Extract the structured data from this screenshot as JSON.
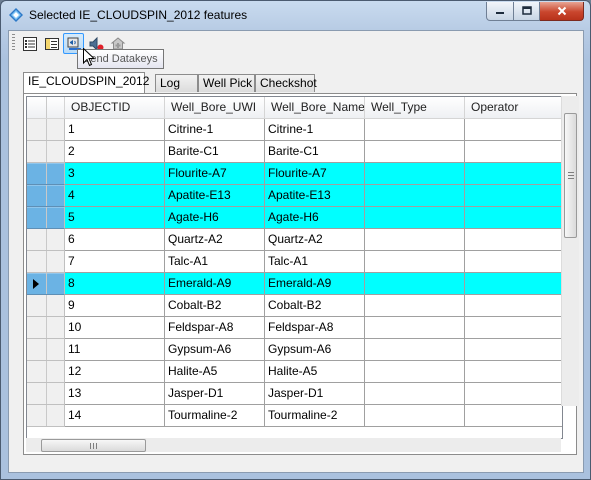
{
  "window": {
    "title": "Selected IE_CLOUDSPIN_2012 features",
    "icon": "layer-diamond-icon"
  },
  "toolbar": {
    "buttons": [
      {
        "icon": "attribute-table-icon"
      },
      {
        "icon": "select-columns-icon"
      },
      {
        "icon": "send-datakeys-icon",
        "active": true
      },
      {
        "icon": "speaker-stop-icon"
      },
      {
        "icon": "house-pin-icon"
      }
    ],
    "tooltip": "Send Datakeys"
  },
  "tabs": [
    {
      "label": "IE_CLOUDSPIN_2012",
      "selected": true
    },
    {
      "label": "Log"
    },
    {
      "label": "Well Pick"
    },
    {
      "label": "Checkshot"
    }
  ],
  "grid": {
    "columns": [
      "OBJECTID",
      "Well_Bore_UWI",
      "Well_Bore_Name",
      "Well_Type",
      "Operator"
    ],
    "rows": [
      {
        "id": "1",
        "uwi": "Citrine-1",
        "name": "Citrine-1",
        "type": "",
        "operator": "",
        "selected": false,
        "current": false
      },
      {
        "id": "2",
        "uwi": "Barite-C1",
        "name": "Barite-C1",
        "type": "",
        "operator": "",
        "selected": false,
        "current": false
      },
      {
        "id": "3",
        "uwi": "Flourite-A7",
        "name": "Flourite-A7",
        "type": "",
        "operator": "",
        "selected": true,
        "current": false
      },
      {
        "id": "4",
        "uwi": "Apatite-E13",
        "name": "Apatite-E13",
        "type": "",
        "operator": "",
        "selected": true,
        "current": false
      },
      {
        "id": "5",
        "uwi": "Agate-H6",
        "name": "Agate-H6",
        "type": "",
        "operator": "",
        "selected": true,
        "current": false
      },
      {
        "id": "6",
        "uwi": "Quartz-A2",
        "name": "Quartz-A2",
        "type": "",
        "operator": "",
        "selected": false,
        "current": false
      },
      {
        "id": "7",
        "uwi": "Talc-A1",
        "name": "Talc-A1",
        "type": "",
        "operator": "",
        "selected": false,
        "current": false
      },
      {
        "id": "8",
        "uwi": "Emerald-A9",
        "name": "Emerald-A9",
        "type": "",
        "operator": "",
        "selected": true,
        "current": true
      },
      {
        "id": "9",
        "uwi": "Cobalt-B2",
        "name": "Cobalt-B2",
        "type": "",
        "operator": "",
        "selected": false,
        "current": false
      },
      {
        "id": "10",
        "uwi": "Feldspar-A8",
        "name": "Feldspar-A8",
        "type": "",
        "operator": "",
        "selected": false,
        "current": false
      },
      {
        "id": "11",
        "uwi": "Gypsum-A6",
        "name": "Gypsum-A6",
        "type": "",
        "operator": "",
        "selected": false,
        "current": false
      },
      {
        "id": "12",
        "uwi": "Halite-A5",
        "name": "Halite-A5",
        "type": "",
        "operator": "",
        "selected": false,
        "current": false
      },
      {
        "id": "13",
        "uwi": "Jasper-D1",
        "name": "Jasper-D1",
        "type": "",
        "operator": "",
        "selected": false,
        "current": false
      },
      {
        "id": "14",
        "uwi": "Tourmaline-2",
        "name": "Tourmaline-2",
        "type": "",
        "operator": "",
        "selected": false,
        "current": false
      }
    ]
  },
  "colors": {
    "selected_row": "#00ffff",
    "selected_row_header": "#6bb3e4",
    "close_button": "#c9462d"
  }
}
